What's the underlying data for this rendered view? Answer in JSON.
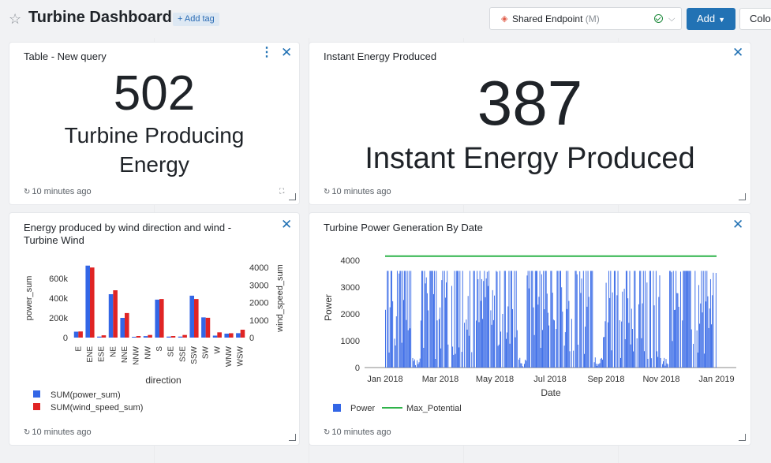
{
  "header": {
    "title": "Turbine Dashboard",
    "add_tag_label": "+ Add tag",
    "endpoint": {
      "name": "Shared Endpoint",
      "suffix": "(M)"
    },
    "add_label": "Add",
    "color_label": "Colo"
  },
  "widgets": {
    "counter_left": {
      "title": "Table - New query",
      "value": "502",
      "label_line1": "Turbine Producing",
      "label_line2": "Energy",
      "footer": "10 minutes ago"
    },
    "counter_right": {
      "title": "Instant Energy Produced",
      "value": "387",
      "label": "Instant Energy Produced",
      "footer": "10 minutes ago"
    },
    "bar_chart": {
      "title_line1": "Energy produced by wind direction and wind -",
      "title_line2": "Turbine Wind",
      "footer": "10 minutes ago"
    },
    "line_chart": {
      "title": "Turbine Power Generation By Date",
      "footer": "10 minutes ago"
    }
  },
  "colors": {
    "accent": "#2272b4",
    "bar_blue": "#3366e6",
    "bar_red": "#e02424",
    "line_green": "#2fb34a"
  },
  "chart_data": [
    {
      "type": "bar",
      "categories": [
        "E",
        "ENE",
        "ESE",
        "NE",
        "NNE",
        "NNW",
        "NW",
        "S",
        "SE",
        "SSE",
        "SSW",
        "SW",
        "W",
        "WNW",
        "WSW"
      ],
      "series": [
        {
          "name": "SUM(power_sum)",
          "axis": "left",
          "values": [
            60000,
            730000,
            10000,
            440000,
            200000,
            8000,
            15000,
            385000,
            10000,
            10000,
            425000,
            205000,
            20000,
            40000,
            45000
          ]
        },
        {
          "name": "SUM(wind_speed_sum)",
          "axis": "right",
          "values": [
            350,
            4000,
            130,
            2700,
            1400,
            90,
            150,
            2200,
            90,
            150,
            2200,
            1130,
            300,
            250,
            450
          ]
        }
      ],
      "xlabel": "direction",
      "ylabel": "power_sum",
      "y2label": "wind_speed_sum",
      "ylim": [
        0,
        800000
      ],
      "y2lim": [
        0,
        4500
      ],
      "yticks": [
        "0",
        "200k",
        "400k",
        "600k"
      ],
      "y2ticks": [
        "0",
        "1000",
        "2000",
        "3000",
        "4000"
      ],
      "legend": "bottom-left"
    },
    {
      "type": "bar",
      "xlabel": "Date",
      "ylabel": "Power",
      "ylim": [
        0,
        4200
      ],
      "yticks": [
        "0",
        "1000",
        "2000",
        "3000",
        "4000"
      ],
      "xticks": [
        "Jan 2018",
        "Mar 2018",
        "May 2018",
        "Jul 2018",
        "Sep 2018",
        "Nov 2018",
        "Jan 2019"
      ],
      "series": [
        {
          "name": "Power",
          "kind": "bar",
          "note": "dense daily values fluctuating between 0 and ~3600"
        },
        {
          "name": "Max_Potential",
          "kind": "line",
          "values": [
            4150,
            4150
          ]
        }
      ],
      "legend": "bottom-left"
    }
  ]
}
